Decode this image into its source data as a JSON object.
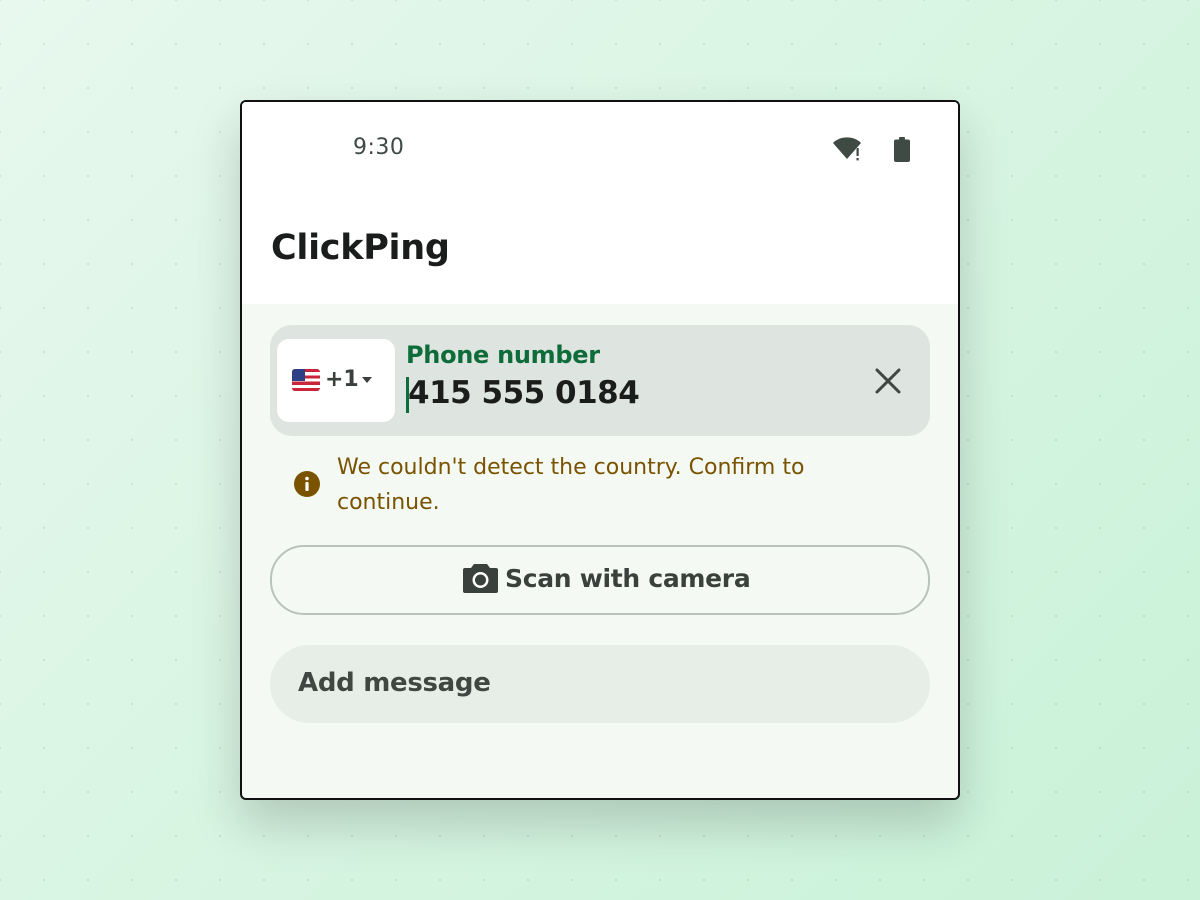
{
  "status_bar": {
    "time": "9:30",
    "wifi_icon": "wifi-alert-icon",
    "battery_icon": "battery-full-icon"
  },
  "app": {
    "title": "ClickPing"
  },
  "phone_field": {
    "country_flag": "us-flag-icon",
    "dial_code": "+1",
    "dropdown_icon": "caret-down-icon",
    "label": "Phone number",
    "value": "415 555 0184",
    "clear_icon": "close-icon",
    "label_color": "#0e6b3a"
  },
  "warning": {
    "icon": "info-icon",
    "text": "We couldn't detect the country. Confirm to continue.",
    "color": "#7a5300"
  },
  "scan_button": {
    "icon": "camera-icon",
    "label": "Scan with camera"
  },
  "message_field": {
    "placeholder": "Add message"
  }
}
